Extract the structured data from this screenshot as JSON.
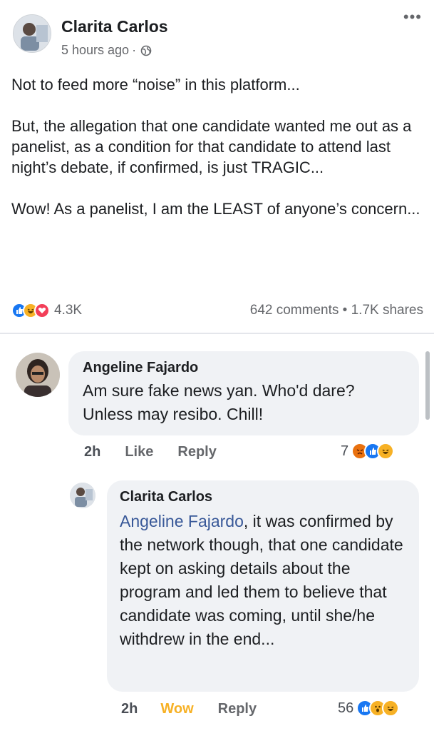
{
  "post": {
    "author": "Clarita Carlos",
    "time": "5 hours ago",
    "separator": "·",
    "more": "•••",
    "paragraphs": [
      "Not to feed more “noise” in this platform...",
      "But, the allegation that one candidate wanted me out as a panelist,  as a condition for that candidate to attend last night’s debate, if confirmed, is just TRAGIC...",
      "Wow!  As a panelist, I am the LEAST of anyone’s concern..."
    ],
    "reaction_count": "4.3K",
    "comments": "642 comments",
    "stat_separator": "•",
    "shares": "1.7K shares",
    "reaction_types": [
      "like",
      "haha",
      "love"
    ]
  },
  "comments": [
    {
      "author": "Angeline Fajardo",
      "text": "Am sure fake news yan. Who'd dare? Unless may resibo. Chill!",
      "time": "2h",
      "like_label": "Like",
      "reply_label": "Reply",
      "reaction_count": "7",
      "reaction_types": [
        "angry",
        "like",
        "haha"
      ]
    },
    {
      "author": "Clarita Carlos",
      "mention": "Angeline Fajardo",
      "text": ", it was confirmed by the network though, that one candidate kept on asking details about the program and led them  to believe that candidate was coming, until she/he withdrew in the end...",
      "time": "2h",
      "like_label": "Wow",
      "reply_label": "Reply",
      "reaction_count": "56",
      "reaction_types": [
        "like",
        "wow",
        "haha"
      ]
    }
  ],
  "colors": {
    "like": "#1877f2",
    "love": "#f33e58",
    "haha": "#f7b125",
    "angry": "#e9710f",
    "wow_label": "#f7b125",
    "mention": "#385898"
  }
}
